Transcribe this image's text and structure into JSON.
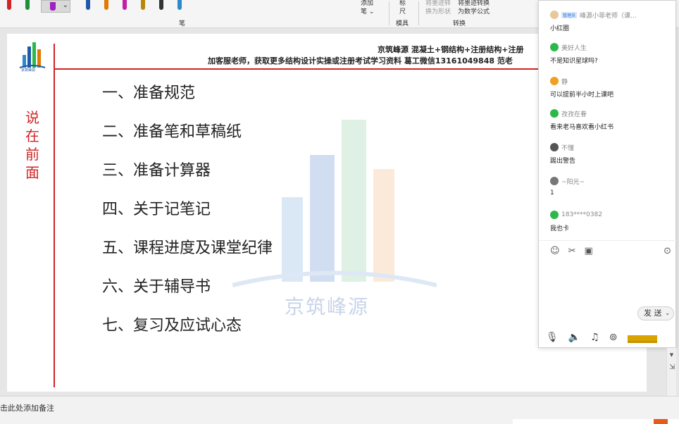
{
  "ribbon": {
    "pen_group_label": "笔",
    "add_pen_line1": "添加",
    "add_pen_line2": "笔 ⌄",
    "ruler_line1": "标",
    "ruler_line2": "尺",
    "stencil_label": "模具",
    "ink_to_shape_line1": "将墨迹转",
    "ink_to_shape_line2": "换为形状",
    "ink_to_math_line1": "将墨迹转换",
    "ink_to_math_line2": "为数学公式",
    "convert_label": "转换",
    "pen_colors": [
      "#d12424",
      "#1f8f3a",
      "#1e5aa8",
      "#e07b00",
      "#c21fa8",
      "#b8860b",
      "#333333",
      "#2a8acb"
    ]
  },
  "slide": {
    "header_line1": "京筑峰源 混凝土+钢结构+注册结构+注册",
    "header_line2": "加客服老师，获取更多结构设计实操或注册考试学习资料 葛工微信13161049848 范老",
    "logo_text": "京筑峰源",
    "side_title": [
      "说",
      "在",
      "前",
      "面"
    ],
    "watermark_text": "京筑峰源",
    "agenda": [
      "一、准备规范",
      "二、准备笔和草稿纸",
      "三、准备计算器",
      "四、关于记笔记",
      "五、课程进度及课堂纪律",
      "六、关于辅导书",
      "七、复习及应试心态"
    ]
  },
  "chat": {
    "messages": [
      {
        "name": "峰源小菲老师（课...",
        "badge": "管理员",
        "text": "小红圈",
        "avatar_color": "#e8c89a"
      },
      {
        "name": "美好人生",
        "badge": "",
        "text": "不是知识星球吗?",
        "avatar_color": "#2cb84a"
      },
      {
        "name": "静",
        "badge": "",
        "text": "可以提前半小时上课吧",
        "avatar_color": "#f0a020"
      },
      {
        "name": "孜孜在眷",
        "badge": "",
        "text": "看来老马喜欢看小红书",
        "avatar_color": "#2cb84a"
      },
      {
        "name": "不懂",
        "badge": "",
        "text": "踢出警告",
        "avatar_color": "#555555"
      },
      {
        "name": "~阳光~",
        "badge": "",
        "text": "1",
        "avatar_color": "#777777"
      },
      {
        "name": "183****0382",
        "badge": "",
        "text": "我也卡",
        "avatar_color": "#2cb84a"
      }
    ],
    "send_label": "发 送"
  },
  "notes": {
    "placeholder": "击此处添加备注"
  }
}
